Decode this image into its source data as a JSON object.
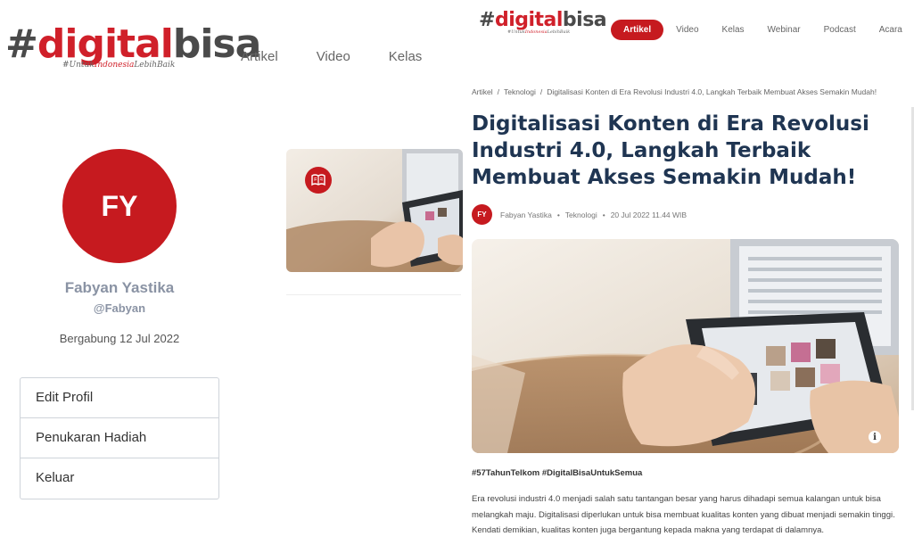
{
  "brand": {
    "hash": "#",
    "d": "d",
    "rest": "igital",
    "bisa": "bisa",
    "tag_prefix": "#UntukIndonesia",
    "tag_highlight": "Indonesia",
    "tag_full_before": "#Untuk",
    "tag_full_after": "LebihBaik"
  },
  "profile_page": {
    "nav": [
      "Artikel",
      "Video",
      "Kelas"
    ],
    "avatar_initials": "FY",
    "name": "Fabyan Yastika",
    "handle": "@Fabyan",
    "joined": "Bergabung 12 Jul 2022",
    "menu": [
      "Edit Profil",
      "Penukaran Hadiah",
      "Keluar"
    ],
    "card_badge_icon": "book-icon"
  },
  "article_page": {
    "nav": [
      "Artikel",
      "Video",
      "Kelas",
      "Webinar",
      "Podcast",
      "Acara"
    ],
    "active_nav": "Artikel",
    "breadcrumb": [
      "Artikel",
      "Teknologi",
      "Digitalisasi Konten di Era Revolusi Industri 4.0, Langkah Terbaik Membuat Akses Semakin Mudah!"
    ],
    "title": "Digitalisasi Konten di Era Revolusi Industri 4.0, Langkah Terbaik Membuat Akses Semakin Mudah!",
    "author_initials": "FY",
    "author": "Fabyan Yastika",
    "category": "Teknologi",
    "date": "20 Jul 2022 11.44 WIB",
    "image_info_icon": "info-icon",
    "hashtags": "#57TahunTelkom #DigitalBisaUntukSemua",
    "body": "Era revolusi industri 4.0 menjadi salah satu tantangan besar yang harus dihadapi semua kalangan untuk bisa melangkah maju. Digitalisasi diperlukan untuk bisa membuat kualitas konten yang dibuat menjadi semakin tinggi. Kendati demikian, kualitas konten juga bergantung kepada makna yang terdapat di dalamnya."
  },
  "colors": {
    "brand_red": "#c61a1f",
    "title_navy": "#1f3552",
    "name_gray": "#8a93a4"
  }
}
